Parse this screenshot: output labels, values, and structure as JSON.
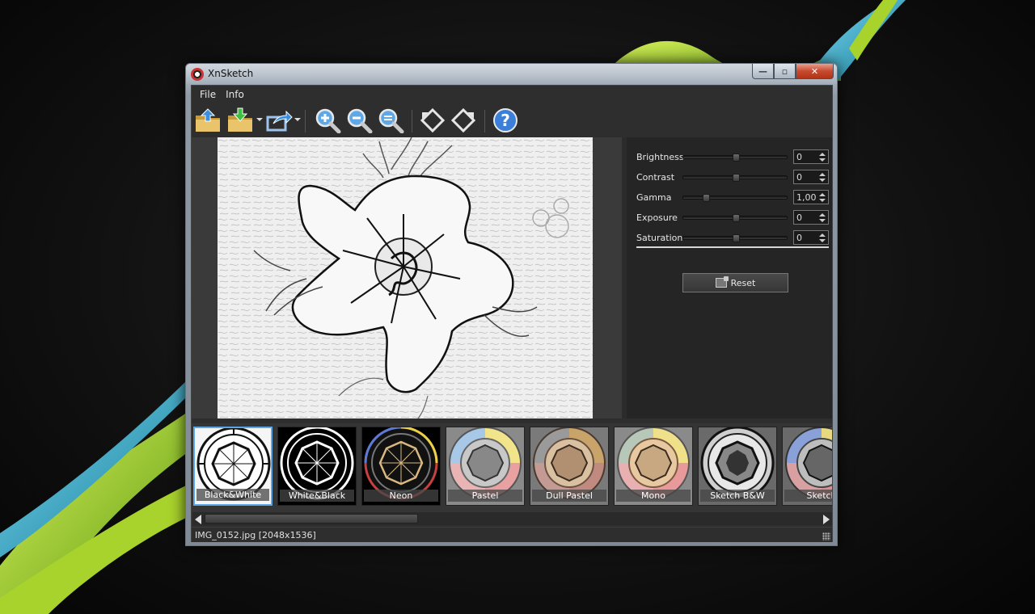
{
  "window": {
    "title": "XnSketch",
    "controls": {
      "minimize": "—",
      "maximize": "▫",
      "close": "✕"
    }
  },
  "menu": {
    "items": [
      "File",
      "Info"
    ]
  },
  "toolbar": {
    "buttons": [
      "open-folder-icon",
      "save-folder-icon",
      "share-icon",
      "zoom-in-icon",
      "zoom-out-icon",
      "zoom-fit-icon",
      "rotate-left-icon",
      "rotate-right-icon",
      "help-icon"
    ],
    "help_label": "?"
  },
  "adjustments": [
    {
      "label": "Brightness",
      "value": "0",
      "level": 0.5
    },
    {
      "label": "Contrast",
      "value": "0",
      "level": 0.5
    },
    {
      "label": "Gamma",
      "value": "1,00",
      "level": 0.2
    },
    {
      "label": "Exposure",
      "value": "0",
      "level": 0.5
    },
    {
      "label": "Saturation",
      "value": "0",
      "level": 0.5
    }
  ],
  "reset_label": "Reset",
  "presets": [
    {
      "label": "Black&White",
      "selected": true,
      "style": "bw"
    },
    {
      "label": "White&Black",
      "selected": false,
      "style": "wb"
    },
    {
      "label": "Neon",
      "selected": false,
      "style": "neon"
    },
    {
      "label": "Pastel",
      "selected": false,
      "style": "pastel"
    },
    {
      "label": "Dull Pastel",
      "selected": false,
      "style": "dull"
    },
    {
      "label": "Mono",
      "selected": false,
      "style": "mono"
    },
    {
      "label": "Sketch B&W",
      "selected": false,
      "style": "sketchbw"
    },
    {
      "label": "Sketch",
      "selected": false,
      "style": "sketch"
    }
  ],
  "status": {
    "file": "IMG_0152.jpg [2048x1536]"
  },
  "colors": {
    "accent": "#5aa8e8",
    "close": "#c74a2f"
  }
}
